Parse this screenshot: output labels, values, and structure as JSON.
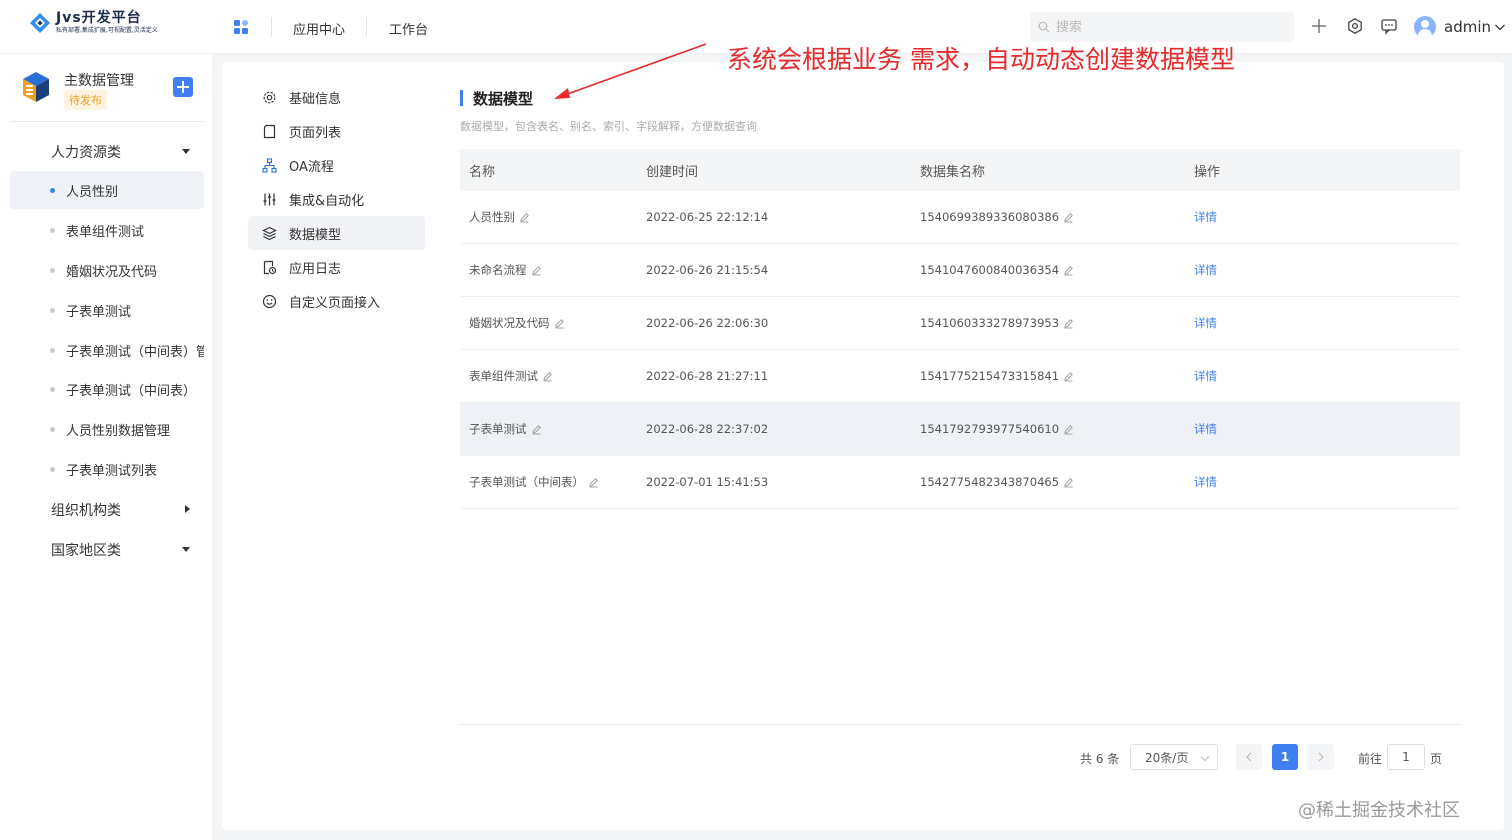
{
  "header": {
    "logo_title": "Jvs开发平台",
    "logo_sub": "私有部署,集成扩展,可视配置,灵活定义",
    "nav": [
      "应用中心",
      "工作台"
    ],
    "search_placeholder": "搜索",
    "user_name": "admin"
  },
  "sidebar": {
    "app_name": "主数据管理",
    "app_status": "待发布",
    "groups": [
      {
        "label": "人力资源类",
        "expanded": true
      },
      {
        "label": "组织机构类",
        "expanded": false
      },
      {
        "label": "国家地区类",
        "expanded": true
      }
    ],
    "items": [
      "人员性别",
      "表单组件测试",
      "婚姻状况及代码",
      "子表单测试",
      "子表单测试（中间表）管",
      "子表单测试（中间表）",
      "人员性别数据管理",
      "子表单测试列表"
    ],
    "active_item": "人员性别"
  },
  "submenu": {
    "items": [
      {
        "label": "基础信息",
        "icon": "gear-icon"
      },
      {
        "label": "页面列表",
        "icon": "page-icon"
      },
      {
        "label": "OA流程",
        "icon": "flow-icon"
      },
      {
        "label": "集成&自动化",
        "icon": "sliders-icon"
      },
      {
        "label": "数据模型",
        "icon": "layers-icon"
      },
      {
        "label": "应用日志",
        "icon": "log-icon"
      },
      {
        "label": "自定义页面接入",
        "icon": "smile-icon"
      }
    ],
    "active": "数据模型"
  },
  "content": {
    "title": "数据模型",
    "description": "数据模型，包含表名、别名、索引、字段解释，方便数据查询",
    "columns": [
      "名称",
      "创建时间",
      "数据集名称",
      "操作"
    ],
    "rows": [
      {
        "name": "人员性别",
        "created": "2022-06-25 22:12:14",
        "dataset": "1540699389336080386",
        "action": "详情"
      },
      {
        "name": "未命名流程",
        "created": "2022-06-26 21:15:54",
        "dataset": "1541047600840036354",
        "action": "详情"
      },
      {
        "name": "婚姻状况及代码",
        "created": "2022-06-26 22:06:30",
        "dataset": "1541060333278973953",
        "action": "详情"
      },
      {
        "name": "表单组件测试",
        "created": "2022-06-28 21:27:11",
        "dataset": "1541775215473315841",
        "action": "详情"
      },
      {
        "name": "子表单测试",
        "created": "2022-06-28 22:37:02",
        "dataset": "1541792793977540610",
        "action": "详情"
      },
      {
        "name": "子表单测试（中间表）",
        "created": "2022-07-01 15:41:53",
        "dataset": "1542775482343870465",
        "action": "详情"
      }
    ],
    "hovered_row": 4
  },
  "pagination": {
    "total": "共 6 条",
    "page_size": "20条/页",
    "current_page": "1",
    "goto_prefix": "前往",
    "goto_value": "1",
    "goto_suffix": "页"
  },
  "annotation": "系统会根据业务 需求，自动动态创建数据模型",
  "watermark_corner": "@稀土掘金技术社区",
  "colors": {
    "accent": "#3f7ff0",
    "annotation": "#e52b2b",
    "pending": "#f0a020"
  }
}
